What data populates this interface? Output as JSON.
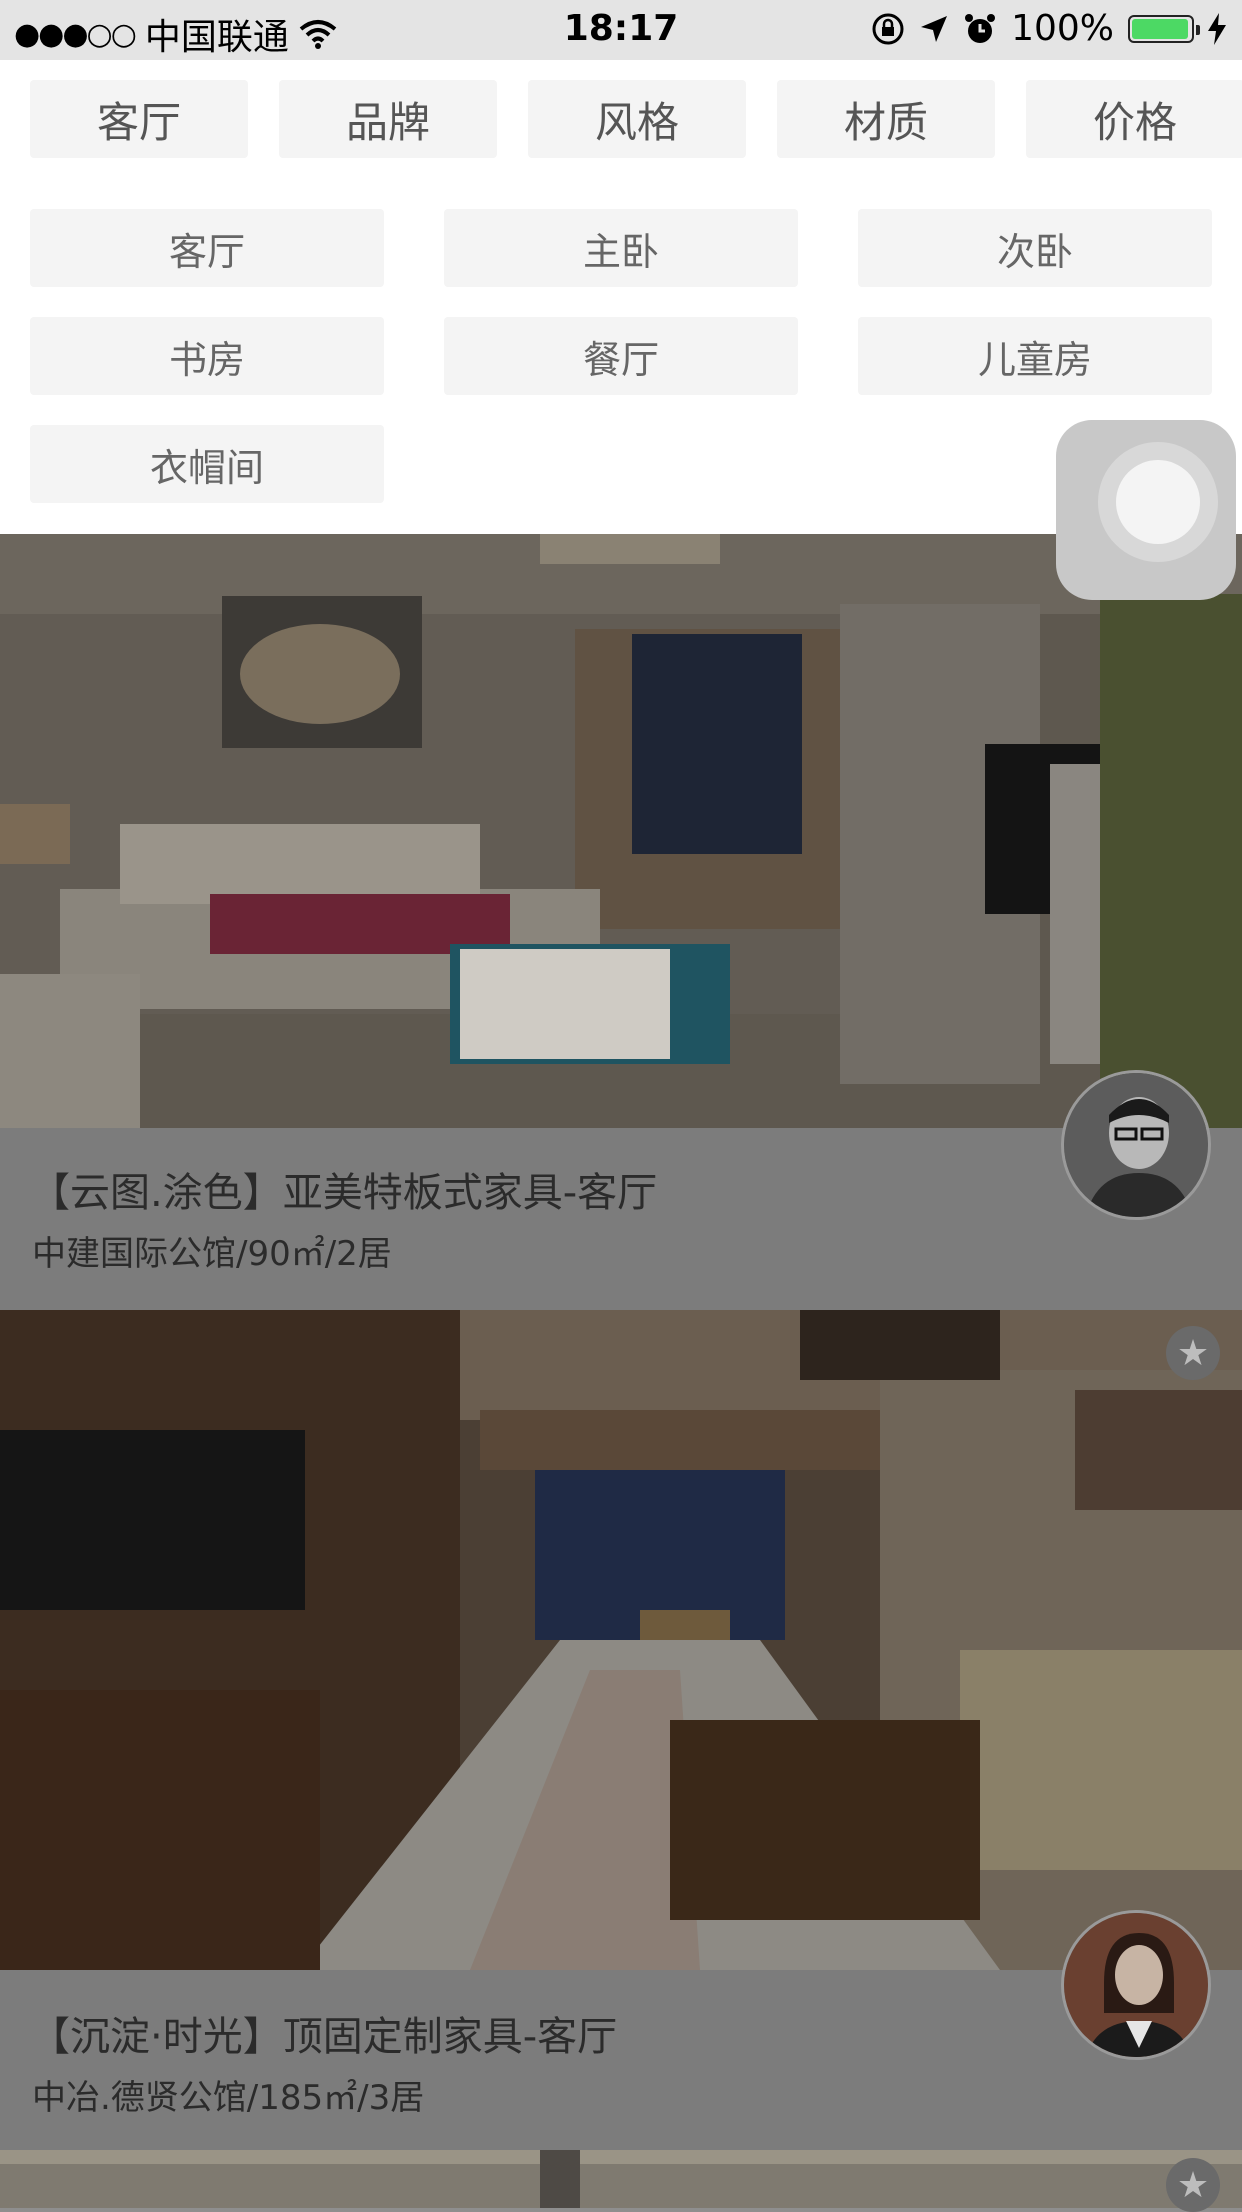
{
  "status_bar": {
    "signal_dots": "●●●○○",
    "carrier": "中国联通",
    "time": "18:17",
    "battery_percent": "100%"
  },
  "filter": {
    "tabs": [
      "客厅",
      "品牌",
      "风格",
      "材质",
      "价格"
    ],
    "options": [
      "客厅",
      "主卧",
      "次卧",
      "书房",
      "餐厅",
      "儿童房",
      "衣帽间"
    ]
  },
  "cards": [
    {
      "title": "【云图.涂色】亚美特板式家具-客厅",
      "subtitle": "中建国际公馆/90㎡/2居"
    },
    {
      "title": "【沉淀·时光】顶固定制家具-客厅",
      "subtitle": "中冶.德贤公馆/185㎡/3居"
    }
  ],
  "icons": {
    "wifi": "wifi-icon",
    "lock_rotation": "rotation-lock-icon",
    "location": "location-arrow-icon",
    "alarm": "alarm-icon",
    "charging": "charging-bolt-icon",
    "favorite": "star-icon"
  },
  "colors": {
    "battery": "#4cd964",
    "overlay": "#7c7c7c"
  }
}
